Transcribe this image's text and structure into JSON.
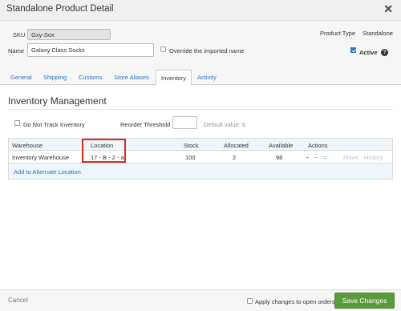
{
  "dialog": {
    "title": "Standalone Product Detail",
    "close_glyph": "✕"
  },
  "header": {
    "sku_label": "SKU",
    "sku_value": "Gxy-Sox",
    "name_label": "Name",
    "name_value": "Galaxy Class Socks",
    "override_label": "Override the imported name",
    "override_checked": false,
    "product_type_label": "Product Type",
    "product_type_value": "Standalone",
    "active_label": "Active",
    "active_checked": true,
    "help_glyph": "?"
  },
  "tabs": [
    {
      "label": "General",
      "active": false
    },
    {
      "label": "Shipping",
      "active": false
    },
    {
      "label": "Customs",
      "active": false
    },
    {
      "label": "Store Aliases",
      "active": false
    },
    {
      "label": "Inventory",
      "active": true
    },
    {
      "label": "Activity",
      "active": false
    }
  ],
  "inventory": {
    "title": "Inventory Management",
    "do_not_track_label": "Do Not Track Inventory",
    "do_not_track_checked": false,
    "reorder_label": "Reorder Threshold",
    "reorder_value": "",
    "default_value_text": "Default value: 6",
    "columns": [
      "Warehouse",
      "Location",
      "Stock",
      "Allocated",
      "Available",
      "Actions"
    ],
    "rows": [
      {
        "warehouse": "Inventory Warehouse",
        "location": "17 - B - 2 - a",
        "stock": "100",
        "allocated": "2",
        "available": "98"
      }
    ],
    "row_actions": {
      "plus": "+",
      "minus": "−",
      "equals": "=",
      "move": "Move",
      "history": "History"
    },
    "add_alternate_label": "Add to Alternate Location"
  },
  "footer": {
    "cancel_label": "Cancel",
    "apply_label": "Apply changes to open orders",
    "apply_checked": false,
    "save_label": "Save Changes"
  },
  "colors": {
    "link": "#2e73c9",
    "save_button": "#5a9b3c",
    "highlight_box": "#e4281c",
    "grid_header": "#eef6fb"
  }
}
